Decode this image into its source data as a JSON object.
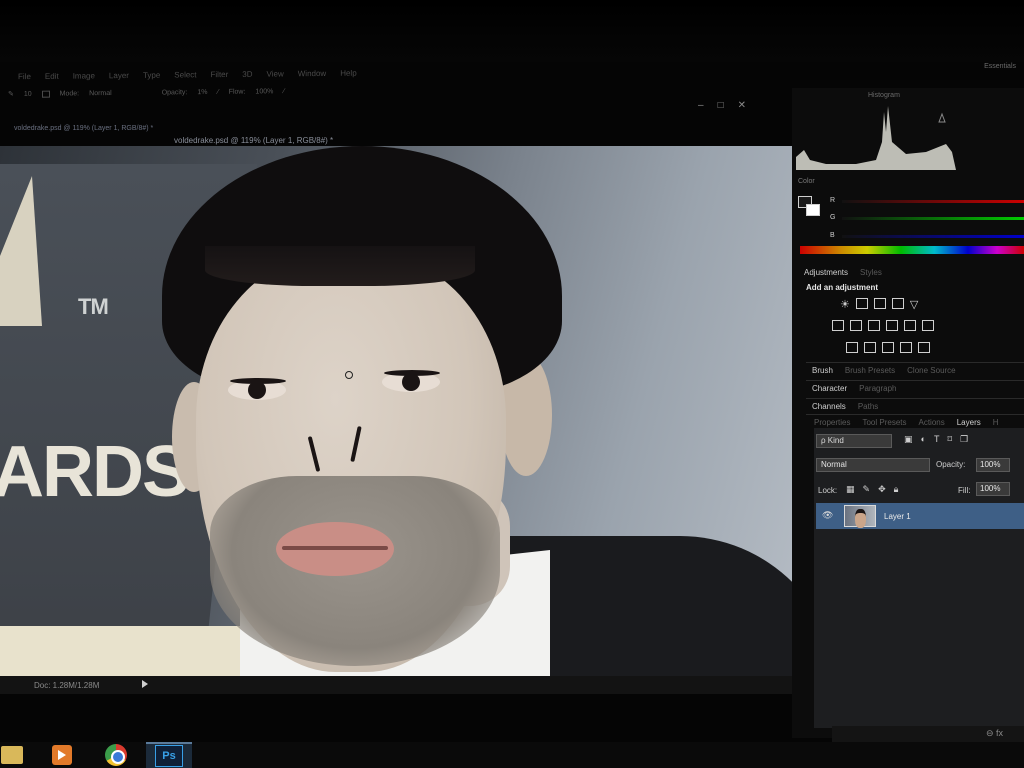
{
  "menu": [
    "File",
    "Edit",
    "Image",
    "Layer",
    "Type",
    "Select",
    "Filter",
    "3D",
    "View",
    "Window",
    "Help"
  ],
  "workspace": "Essentials",
  "options": {
    "brush_size": "10",
    "mode_label": "Mode:",
    "mode_value": "Normal",
    "opacity_label": "Opacity:",
    "opacity_value": "1%",
    "flow_label": "Flow:",
    "flow_value": "100%"
  },
  "tabs": {
    "doc_tab": "voldedrake.psd @ 119% (Layer 1, RGB/8#) *",
    "doc_title": "voldedrake.psd @ 119% (Layer 1, RGB/8#) *"
  },
  "window_controls": {
    "min": "–",
    "max": "□",
    "close": "✕"
  },
  "canvas": {
    "tm": "TM",
    "awards": "ARDS"
  },
  "status": {
    "doc": "Doc: 1.28M/1.28M"
  },
  "panels": {
    "histogram_title": "Histogram",
    "color_title": "Color",
    "channels": [
      "R",
      "G",
      "B"
    ],
    "adjustments_tabs": [
      "Adjustments",
      "Styles"
    ],
    "add_adjustment": "Add an adjustment",
    "brush_tabs": [
      "Brush",
      "Brush Presets",
      "Clone Source"
    ],
    "character_tabs": [
      "Character",
      "Paragraph"
    ],
    "channels_tabs": [
      "Channels",
      "Paths"
    ],
    "layers_tabs": [
      "Properties",
      "Tool Presets",
      "Actions",
      "Layers",
      "H"
    ]
  },
  "layers": {
    "kind": "ρ Kind",
    "blend_mode": "Normal",
    "opacity_label": "Opacity:",
    "opacity_value": "100%",
    "lock_label": "Lock:",
    "fill_label": "Fill:",
    "fill_value": "100%",
    "layer_name": "Layer 1",
    "footer": "⊖ fx"
  },
  "taskbar": {
    "ps_label": "Ps"
  },
  "colors": {
    "selected_layer": "#3e5f86",
    "ps_blue": "#38a0e8"
  }
}
